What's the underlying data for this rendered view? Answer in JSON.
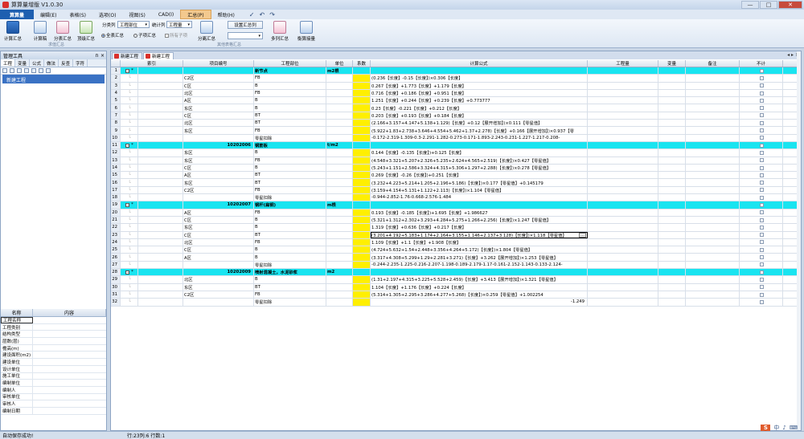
{
  "window": {
    "title": "算算量增版 V1.0.30",
    "min": "—",
    "max": "□",
    "close": "✕"
  },
  "menu": {
    "app": "算算量",
    "items": [
      "编辑(E)",
      "表格(S)",
      "选项(O)",
      "视图(S)",
      "CAD(I)",
      "汇总(P)",
      "帮助(H)"
    ],
    "active_index": 5
  },
  "quick_access": [
    "✓",
    "↶",
    "↷"
  ],
  "ribbon": {
    "btn_calc_total": "计算汇总",
    "btn_calc_prog": "计算稿",
    "btn_sub_total": "分表汇总",
    "btn_top_total": "顶级汇总",
    "group_total": "求值汇总",
    "col_label": "分类列",
    "col_value": "工程部位",
    "stat_label": "统计列",
    "stat_value": "工程量",
    "radio_all": "全表汇总",
    "radio_sub": "子项汇总",
    "chk_all_sub": "所有子项",
    "btn_sep": "分离汇总",
    "btn_setting": "设置汇总列",
    "group_other": "其他表格汇总",
    "btn_multi": "多列汇总",
    "btn_measure": "衡算接量"
  },
  "left_panel": {
    "title": "管理工具",
    "pin": "ᴨ",
    "close": "×",
    "tabs": [
      "工程",
      "变量",
      "公式",
      "做法",
      "反查",
      "字符"
    ],
    "tree": [
      "新建工程"
    ],
    "props_header": [
      "名称",
      "内容"
    ],
    "props": [
      "工程名称",
      "工程类别",
      "结构类型",
      "层数(层)",
      "檐高(m)",
      "建设面积(m2)",
      "建设单位",
      "设计单位",
      "施工单位",
      "编制单位",
      "编制人",
      "审核单位",
      "审核人",
      "编制日期"
    ]
  },
  "doc_tabs": [
    "新建工程",
    "新建工程"
  ],
  "doc_nav": "◂ ▸ ×",
  "grid": {
    "headers": [
      "索引",
      "",
      "项目编号",
      "工程部位",
      "单位",
      "系数",
      "计算公式",
      "工程量",
      "变量",
      "备注",
      "不计"
    ],
    "rows": [
      {
        "n": "1",
        "g": true,
        "s": "*",
        "code": "",
        "part": "新节点",
        "unit": "m2根",
        "f": ""
      },
      {
        "n": "2",
        "code": "C2区",
        "part": "FB",
        "unit": "",
        "f": "(0.236【长度】-0.15【长度】)×0.306【长度】"
      },
      {
        "n": "3",
        "code": "C区",
        "part": "B",
        "unit": "",
        "f": "0.267【长度】+1.773【长度】+1.179【长度】"
      },
      {
        "n": "4",
        "code": "北区",
        "part": "FB",
        "unit": "",
        "f": "0.716【长度】+0.186【长度】+0.951【长度】"
      },
      {
        "n": "5",
        "code": "A区",
        "part": "B",
        "unit": "",
        "f": "1.251【长度】+0.244【长度】+0.239【长度】+0.773777"
      },
      {
        "n": "6",
        "code": "东区",
        "part": "B",
        "unit": "",
        "f": "0.23【长度】-0.221【长度】+0.212【长度】"
      },
      {
        "n": "7",
        "code": "C区",
        "part": "BT",
        "unit": "",
        "f": "0.203【长度】+0.193【长度】+0.184【长度】"
      },
      {
        "n": "8",
        "code": "北区",
        "part": "BT",
        "unit": "",
        "f": "(2.166+3.157+4.147+5.138+1.129)【长度】+0.12【展开增加】)×0.111【零星值】"
      },
      {
        "n": "9",
        "code": "东区",
        "part": "FB",
        "unit": "",
        "f": "(5.922+1.83+2.738+3.646+4.554+5.462+1.37+2.278)【长度】+0.166【展开增加】)×0.937【零"
      },
      {
        "n": "10",
        "code": "",
        "part": "零星扣除",
        "unit": "",
        "f": "-0.172-2.319-1.309-0.3-2.291-1.282-0.273-0.171-1.893-2.243-0.231-1.227-1.217-0.208-"
      },
      {
        "n": "11",
        "g": true,
        "s": "*",
        "code": "10202006",
        "part": "钢筋板",
        "unit": "t/m2",
        "f": ""
      },
      {
        "n": "12",
        "code": "东区",
        "part": "B",
        "unit": "",
        "f": "0.144【长度】-0.135【长度】)+0.125【长度】"
      },
      {
        "n": "13",
        "code": "东区",
        "part": "FB",
        "unit": "",
        "f": "(4.548+3.321+5.207+2.326+5.235+2.624+4.565+2.519)【长度】)×0.427【零星值】"
      },
      {
        "n": "14",
        "code": "C区",
        "part": "B",
        "unit": "",
        "f": "(5.243+1.151+2.586+3.324+4.315+5.306+1.297+2.288)【长度】)×0.278【零星值】"
      },
      {
        "n": "15",
        "code": "A区",
        "part": "BT",
        "unit": "",
        "f": "0.269【长度】-0.26【长度】)+0.251【长度】"
      },
      {
        "n": "16",
        "code": "东区",
        "part": "BT",
        "unit": "",
        "f": "(3.232+4.223+5.214+1.205+2.196+5.186)【长度】)×0.177【零星值】+0.145179"
      },
      {
        "n": "17",
        "code": "C2区",
        "part": "FB",
        "unit": "",
        "f": "(3.159+4.154+5.131+1.122+2.113)【长度】)×1.104【零星值】"
      },
      {
        "n": "18",
        "code": "",
        "part": "零星扣除",
        "unit": "",
        "f": "-0.944-2.852-1.76-0.668-2.576-1.484"
      },
      {
        "n": "19",
        "g": true,
        "s": "*",
        "code": "10202007",
        "part": "钢杆(扁钢)",
        "unit": "m根",
        "f": ""
      },
      {
        "n": "20",
        "code": "A区",
        "part": "FB",
        "unit": "",
        "f": "0.193【长度】-0.185【长度】)+1.695【长度】+1.986627"
      },
      {
        "n": "21",
        "code": "C区",
        "part": "B",
        "unit": "",
        "f": "(5.321+1.312+2.302+3.293+4.284+5.275+1.266+2.256)【长度】)×1.247【零星值】"
      },
      {
        "n": "22",
        "code": "东区",
        "part": "B",
        "unit": "",
        "f": "1.319【长度】+0.636【长度】+0.217【长度】"
      },
      {
        "n": "23",
        "code": "C区",
        "part": "BT",
        "unit": "",
        "f": "(3.201+4.192+5.183+1.174+2.164+3.155+1.146+2.137+3.128)【长度】)×1.118【零星值】",
        "sel": true
      },
      {
        "n": "24",
        "code": "北区",
        "part": "FB",
        "unit": "",
        "f": "1.109【长度】+1.1【长度】+1.908【长度】"
      },
      {
        "n": "25",
        "code": "C区",
        "part": "B",
        "unit": "",
        "f": "(4.724+5.632+1.54+2.448+3.356+4.264+5.172)【长度】)×1.804【零星值】"
      },
      {
        "n": "26",
        "code": "A区",
        "part": "B",
        "unit": "",
        "f": "(3.317+4.308+5.299+1.29+2.281+3.271)【长度】+3.262【展开增加】)×1.253【零星值】"
      },
      {
        "n": "27",
        "code": "",
        "part": "零星扣除",
        "unit": "",
        "f": "-0.244-2.235-1.225-0.216-2.207-1.198-0.189-2.179-1.17-0.161-2.152-1.143-0.133-2.124-"
      },
      {
        "n": "28",
        "g": true,
        "s": "*",
        "code": "10202009",
        "part": "喷射混凝土，水泥砂浆",
        "unit": "m2",
        "f": ""
      },
      {
        "n": "29",
        "code": "北区",
        "part": "B",
        "unit": "",
        "f": "(1.31+2.197+4.315+3.225+5.528+2.459)【长度】+3.413【展开增加】)×1.321【零星值】"
      },
      {
        "n": "30",
        "code": "东区",
        "part": "BT",
        "unit": "",
        "f": "1.104【长度】+1.176【长度】+0.224【长度】"
      },
      {
        "n": "31",
        "code": "C2区",
        "part": "FB",
        "unit": "",
        "f": "(5.314+1.305+2.295+3.286+4.277+5.268)【长度】)×0.259【零星值】+1.002254"
      },
      {
        "n": "32",
        "code": "",
        "part": "零星扣除",
        "unit": "",
        "f": "",
        "val": "-1.249"
      }
    ]
  },
  "status": {
    "left": "自动保存成功!",
    "position": "行:23列:6  行数:1"
  },
  "watermark": {
    "big": "Baid经验",
    "small": "jingyan.baidu.com"
  },
  "tray": {
    "logo": "S"
  }
}
